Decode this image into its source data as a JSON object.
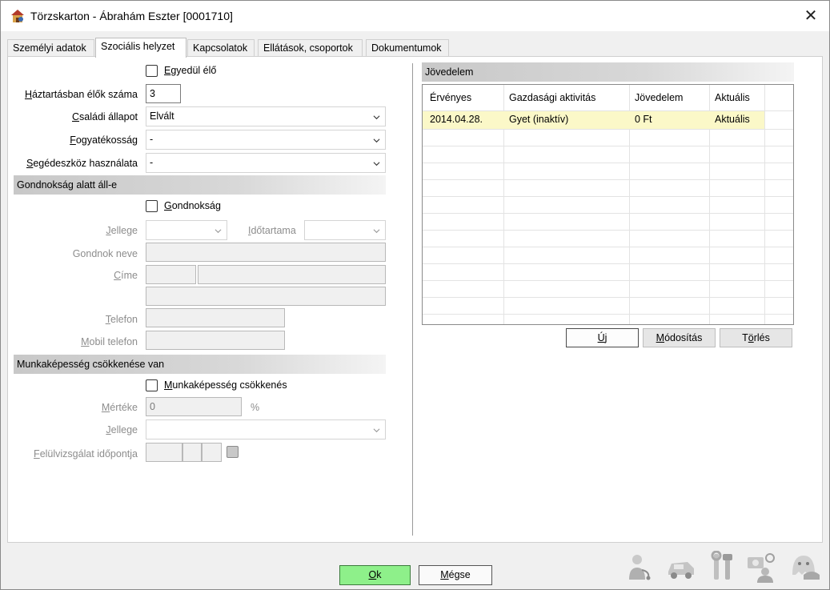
{
  "window": {
    "title": "Törzskarton - Ábrahám Eszter [0001710]",
    "close_glyph": "✕"
  },
  "tabs": [
    {
      "label": "Személyi adatok",
      "active": false
    },
    {
      "label": "Szociális helyzet",
      "active": true
    },
    {
      "label": "Kapcsolatok",
      "active": false
    },
    {
      "label": "Ellátások, csoportok",
      "active": false
    },
    {
      "label": "Dokumentumok",
      "active": false
    }
  ],
  "left": {
    "egyedul_elo": {
      "label_first": "E",
      "label_rest": "gyedül élő",
      "checked": false
    },
    "haztartas": {
      "label_first": "H",
      "label_rest": "áztartásban élők száma",
      "value": "3"
    },
    "csaladi": {
      "label_first": "C",
      "label_rest": "saládi állapot",
      "value": "Elvált"
    },
    "fogyatekossag": {
      "label_first": "F",
      "label_rest": "ogyatékosság",
      "value": "-"
    },
    "segedeszkoz": {
      "label_first": "S",
      "label_rest": "egédeszköz használata",
      "value": "-"
    },
    "gondnoksag_section": "Gondnokság alatt áll-e",
    "gondnoksag": {
      "label_first": "G",
      "label_rest": "ondnokság",
      "checked": false
    },
    "jellege_first": "J",
    "jellege_rest": "ellege",
    "idotartama_first": "I",
    "idotartama_rest": "dőtartama",
    "gondnok_neve": "Gondnok neve",
    "cime_first": "C",
    "cime_rest": "íme",
    "telefon_first": "T",
    "telefon_rest": "elefon",
    "mobil_first": "M",
    "mobil_rest": "obil telefon",
    "munka_section": "Munkaképesség csökkenése van",
    "munka": {
      "label_first": "M",
      "label_rest": "unkaképesség csökkenés",
      "checked": false
    },
    "merteke_first": "M",
    "merteke_rest": "értéke",
    "merteke_value": "0",
    "percent": "%",
    "jellege2_first": "J",
    "jellege2_rest": "ellege",
    "felulvizsgalat_first": "F",
    "felulvizsgalat_rest": "elülvizsgálat időpontja"
  },
  "right": {
    "section": "Jövedelem",
    "columns": [
      "Érvényes",
      "Gazdasági aktivitás",
      "Jövedelem",
      "Aktuális"
    ],
    "rows": [
      {
        "ervenyes": "2014.04.28.",
        "aktivitas": "Gyet (inaktív)",
        "jovedelem": "0 Ft",
        "aktualis": "Aktuális"
      }
    ],
    "buttons": {
      "uj_first": "Ú",
      "uj_rest": "j",
      "modositas_first": "M",
      "modositas_rest": "ódosítás",
      "torles_prefix": "T",
      "torles_mid": "ö",
      "torles_rest": "rlés"
    }
  },
  "footer": {
    "ok_first": "O",
    "ok_rest": "k",
    "cancel_first": "M",
    "cancel_rest": "égse",
    "icons": [
      "doctor-icon",
      "car-icon",
      "tools-icon",
      "camera-person-icon",
      "ghost-icon"
    ]
  },
  "colors": {
    "ok_button": "#8ef08a",
    "row_highlight": "#fbf8c8",
    "section_bar": "#c8c8c8"
  }
}
